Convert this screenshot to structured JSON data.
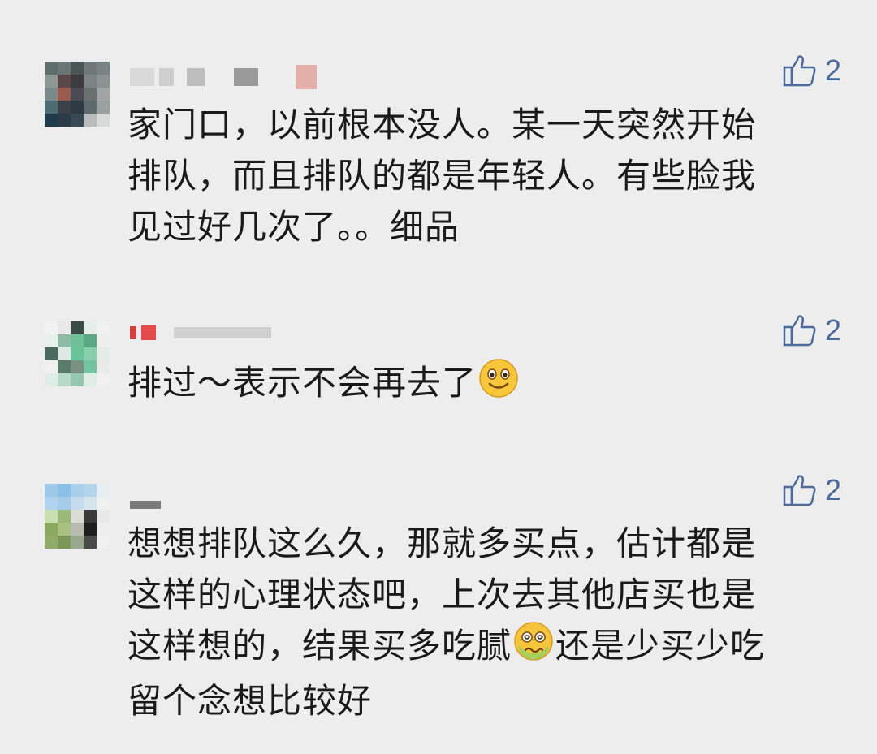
{
  "comments": [
    {
      "text_lines": [
        "家门口，以前根本没人。某一天突然开始",
        "排队，而且排队的都是年轻人。有些脸我",
        "见过好几次了。。细品"
      ],
      "likes": "2",
      "nickname_obscured": true,
      "avatar_obscured": true
    },
    {
      "text_before_emoji": "排过～表示不会再去了",
      "emoji": "smile-emoji",
      "likes": "2",
      "nickname_obscured": true,
      "avatar_obscured": true
    },
    {
      "text_lines": [
        "想想排队这么久，那就多买点，估计都是",
        "这样的心理状态吧，上次去其他店买也是"
      ],
      "line3_before_emoji": "这样想的，结果买多吃腻",
      "line3_emoji": "nauseated-emoji",
      "line3_after_emoji": "还是少买少吃",
      "line4": "留个念想比较好",
      "likes": "2",
      "nickname_obscured": true,
      "avatar_obscured": true
    }
  ],
  "icons": {
    "like": "thumbs-up-icon"
  },
  "colors": {
    "background": "#ededed",
    "text": "#1a1a1a",
    "like": "#4c6a9c"
  }
}
